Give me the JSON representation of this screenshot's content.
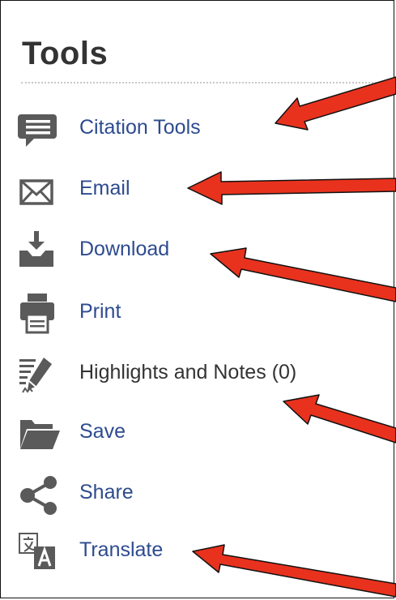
{
  "panel": {
    "title": "Tools",
    "items": [
      {
        "label": "Citation Tools",
        "icon": "speech-bubble-icon"
      },
      {
        "label": "Email",
        "icon": "envelope-icon"
      },
      {
        "label": "Download",
        "icon": "download-icon"
      },
      {
        "label": "Print",
        "icon": "printer-icon"
      },
      {
        "label": "Highlights and Notes (0)",
        "icon": "pencil-notes-icon"
      },
      {
        "label": "Save",
        "icon": "folder-icon"
      },
      {
        "label": "Share",
        "icon": "share-icon"
      },
      {
        "label": "Translate",
        "icon": "translate-icon"
      }
    ]
  },
  "colors": {
    "link": "#2d4b8f",
    "icon": "#5a5a5a",
    "arrow": "#e8321e",
    "heading": "#333333"
  }
}
